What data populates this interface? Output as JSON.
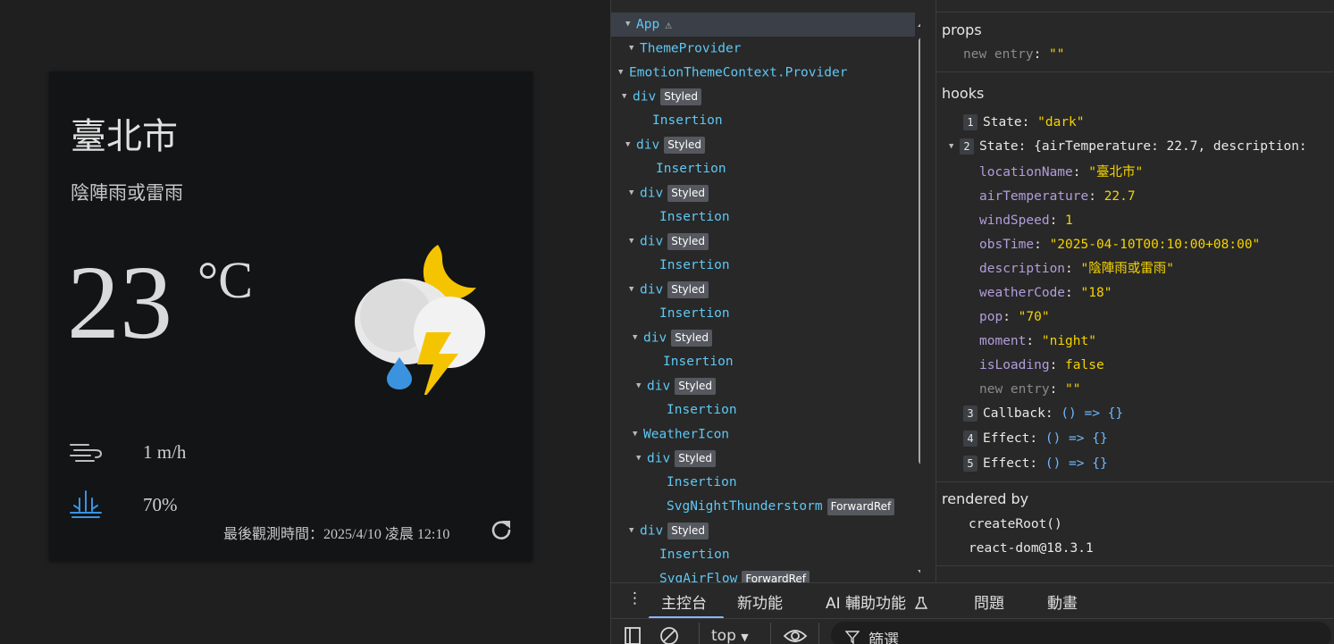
{
  "weather_card": {
    "city": "臺北市",
    "description": "陰陣雨或雷雨",
    "temperature": "23",
    "unit": "°C",
    "wind": "1 m/h",
    "rain": "70%",
    "observed": "最後觀測時間：2025/4/10 凌晨 12:10"
  },
  "tree": {
    "rows": [
      {
        "label": "App",
        "badge": ""
      },
      {
        "label": "ThemeProvider",
        "badge": ""
      },
      {
        "label": "EmotionThemeContext.Provider",
        "badge": ""
      },
      {
        "label": "div",
        "badge": "Styled"
      },
      {
        "label": "Insertion",
        "badge": ""
      },
      {
        "label": "div",
        "badge": "Styled"
      },
      {
        "label": "Insertion",
        "badge": ""
      },
      {
        "label": "div",
        "badge": "Styled"
      },
      {
        "label": "Insertion",
        "badge": ""
      },
      {
        "label": "div",
        "badge": "Styled"
      },
      {
        "label": "Insertion",
        "badge": ""
      },
      {
        "label": "div",
        "badge": "Styled"
      },
      {
        "label": "Insertion",
        "badge": ""
      },
      {
        "label": "div",
        "badge": "Styled"
      },
      {
        "label": "Insertion",
        "badge": ""
      },
      {
        "label": "div",
        "badge": "Styled"
      },
      {
        "label": "Insertion",
        "badge": ""
      },
      {
        "label": "WeatherIcon",
        "badge": ""
      },
      {
        "label": "div",
        "badge": "Styled"
      },
      {
        "label": "Insertion",
        "badge": ""
      },
      {
        "label": "SvgNightThunderstorm",
        "badge": "ForwardRef"
      },
      {
        "label": "div",
        "badge": "Styled"
      },
      {
        "label": "Insertion",
        "badge": ""
      },
      {
        "label": "SvgAirFlow",
        "badge": "ForwardRef"
      }
    ]
  },
  "props": {
    "title": "props",
    "new_entry_key": "new entry",
    "new_entry_val": "\"\""
  },
  "hooks": {
    "title": "hooks",
    "h1_label": "State:",
    "h1_val": "\"dark\"",
    "h2_label": "State:",
    "h2_val": "{airTemperature: 22.7, description:",
    "fields": [
      {
        "k": "locationName",
        "v": "\"臺北市\""
      },
      {
        "k": "airTemperature",
        "v": "22.7"
      },
      {
        "k": "windSpeed",
        "v": "1"
      },
      {
        "k": "obsTime",
        "v": "\"2025-04-10T00:10:00+08:00\""
      },
      {
        "k": "description",
        "v": "\"陰陣雨或雷雨\""
      },
      {
        "k": "weatherCode",
        "v": "\"18\""
      },
      {
        "k": "pop",
        "v": "\"70\""
      },
      {
        "k": "moment",
        "v": "\"night\""
      },
      {
        "k": "isLoading",
        "v": "false"
      }
    ],
    "new_entry_key": "new entry",
    "new_entry_val": "\"\"",
    "h3_label": "Callback:",
    "h4_label": "Effect:",
    "h5_label": "Effect:",
    "fn_val": "() => {}"
  },
  "rendered_by": {
    "title": "rendered by",
    "items": [
      "createRoot()",
      "react-dom@18.3.1"
    ]
  },
  "drawer": {
    "tabs": [
      "主控台",
      "新功能",
      "AI 輔助功能",
      "問題",
      "動畫"
    ],
    "context": "top",
    "filter": "篩選"
  }
}
